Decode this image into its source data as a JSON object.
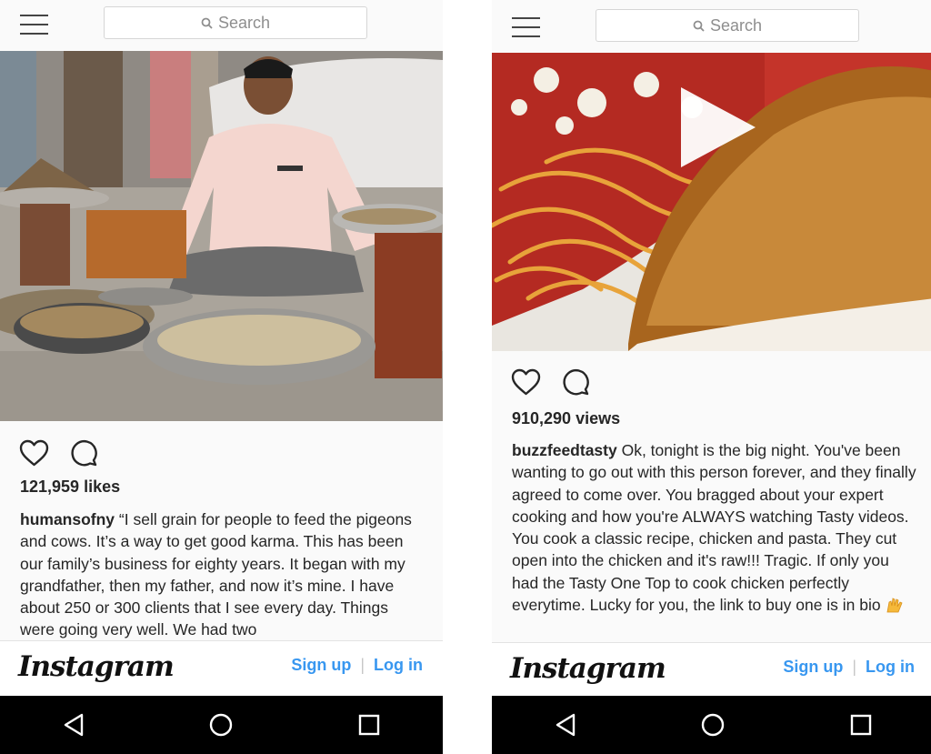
{
  "left": {
    "search": {
      "placeholder": "Search"
    },
    "likes": "121,959 likes",
    "caption": {
      "username": "humansofny",
      "text": " “I sell grain for people to feed the pigeons and cows. It’s a way to get good karma. This has been our family’s business for eighty years. It began with my grandfather, then my father, and now it’s mine. I have about 250 or 300 clients that I see every day. Things were going very well. We had two"
    },
    "footer": {
      "logo": "Instagram",
      "signup": "Sign up",
      "separator": "|",
      "login": "Log in"
    }
  },
  "right": {
    "search": {
      "placeholder": "Search"
    },
    "views": "910,290 views",
    "caption": {
      "username": "buzzfeedtasty",
      "text": " Ok, tonight is the big night. You've been wanting to go out with this person forever, and they finally agreed to come over. You bragged about your expert cooking and how you're ALWAYS watching Tasty videos. You cook a classic recipe, chicken and pasta. They cut open into the chicken and it's raw!!! Tragic. If only you had the Tasty One Top to cook chicken perfectly everytime. Lucky for you, the link to buy one is in bio",
      "emoji": "raised-hands-emoji"
    },
    "footer": {
      "logo": "Instagram",
      "signup": "Sign up",
      "separator": "|",
      "login": "Log in"
    }
  },
  "icons": {
    "menu": "hamburger-menu-icon",
    "search": "search-icon",
    "like": "heart-icon",
    "comment": "comment-icon",
    "play": "play-icon",
    "nav_back": "back-triangle-icon",
    "nav_home": "home-circle-icon",
    "nav_recents": "recents-square-icon"
  },
  "colors": {
    "link": "#3897f0",
    "text": "#262626",
    "navbar": "#000000"
  }
}
